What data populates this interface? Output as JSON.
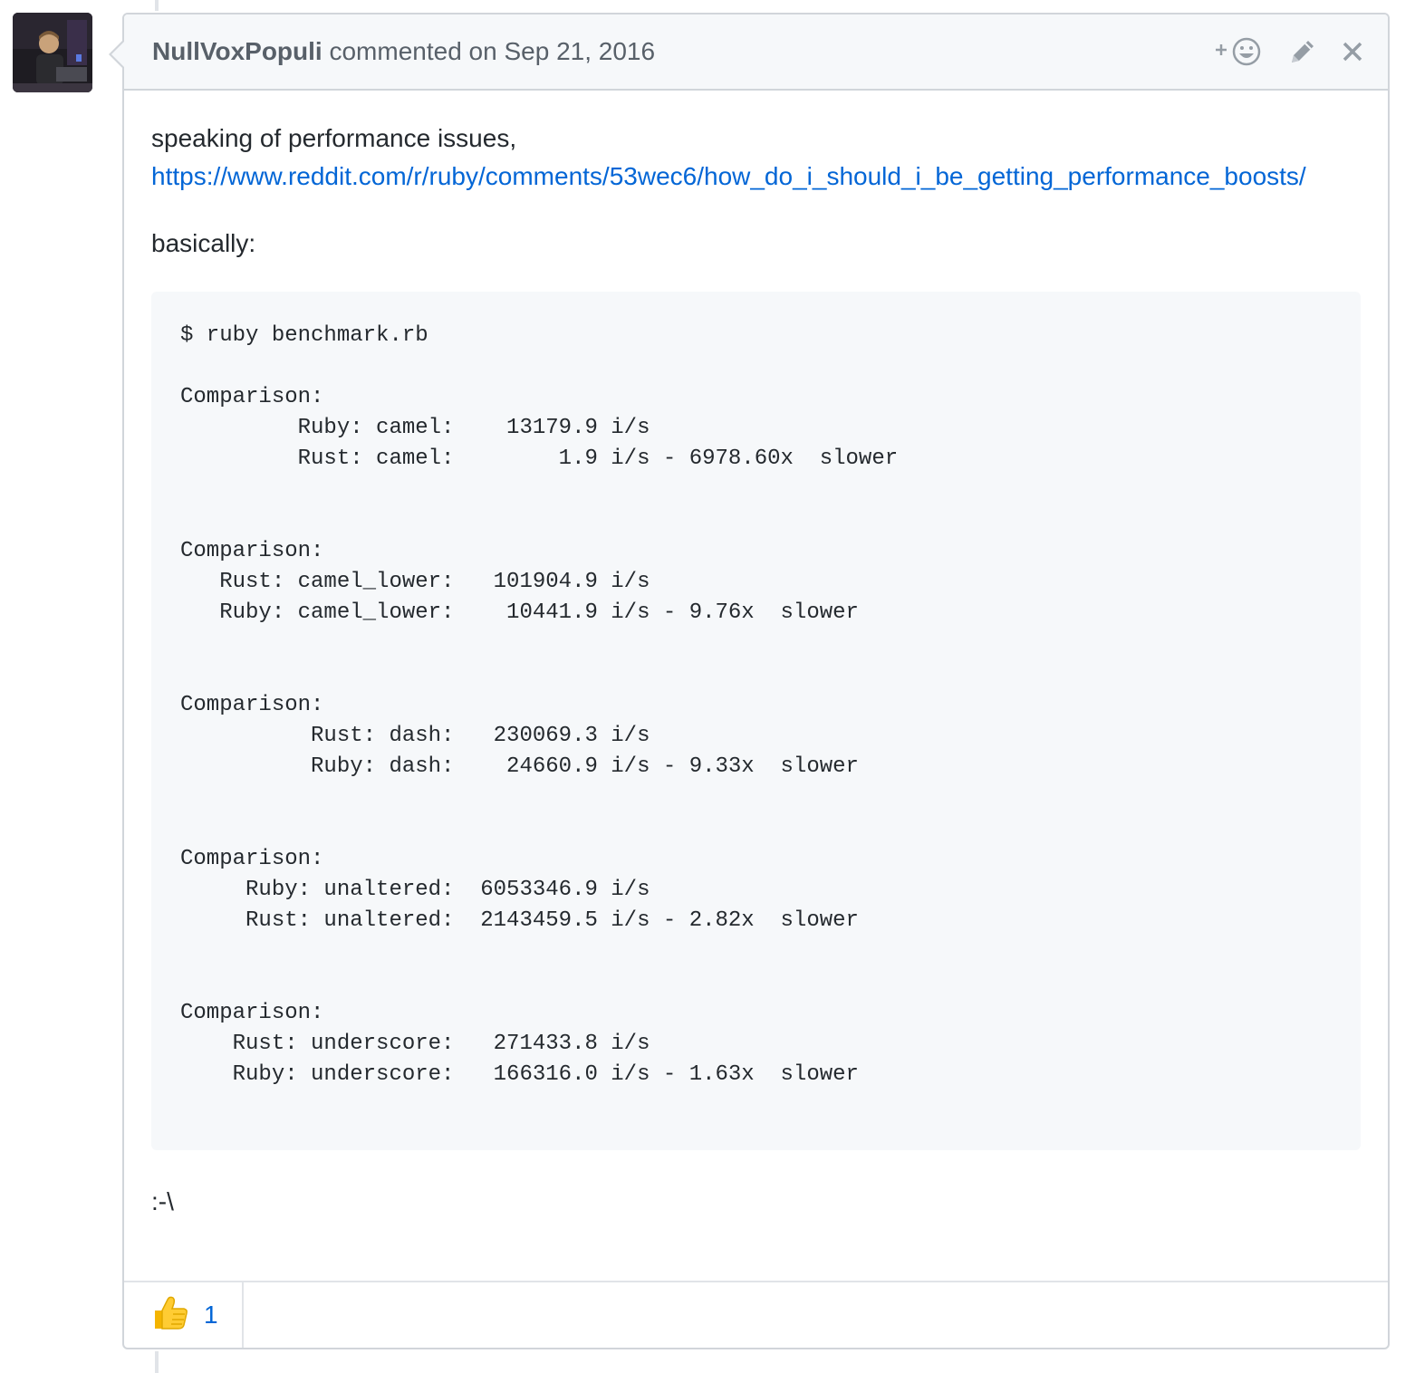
{
  "comment": {
    "author": "NullVoxPopuli",
    "action_text": "commented on",
    "date": "Sep 21, 2016",
    "body": {
      "intro": "speaking of performance issues,",
      "link": "https://www.reddit.com/r/ruby/comments/53wec6/how_do_i_should_i_be_getting_performance_boosts/",
      "lead": "basically:",
      "code": "$ ruby benchmark.rb\n\nComparison:\n         Ruby: camel:    13179.9 i/s\n         Rust: camel:        1.9 i/s - 6978.60x  slower\n\n\nComparison:\n   Rust: camel_lower:   101904.9 i/s\n   Ruby: camel_lower:    10441.9 i/s - 9.76x  slower\n\n\nComparison:\n          Rust: dash:   230069.3 i/s\n          Ruby: dash:    24660.9 i/s - 9.33x  slower\n\n\nComparison:\n     Ruby: unaltered:  6053346.9 i/s\n     Rust: unaltered:  2143459.5 i/s - 2.82x  slower\n\n\nComparison:\n    Rust: underscore:   271433.8 i/s\n    Ruby: underscore:   166316.0 i/s - 1.63x  slower",
      "closing": ":-\\"
    },
    "reactions": [
      {
        "emoji": "thumbs-up-icon",
        "count": "1"
      }
    ]
  },
  "colors": {
    "link": "#0366d6",
    "header_bg": "#f6f8fa",
    "border": "#d1d5da",
    "muted_text": "#586069"
  },
  "icons": {
    "add_reaction": "add-reaction-icon",
    "edit": "pencil-icon",
    "delete": "close-icon"
  }
}
